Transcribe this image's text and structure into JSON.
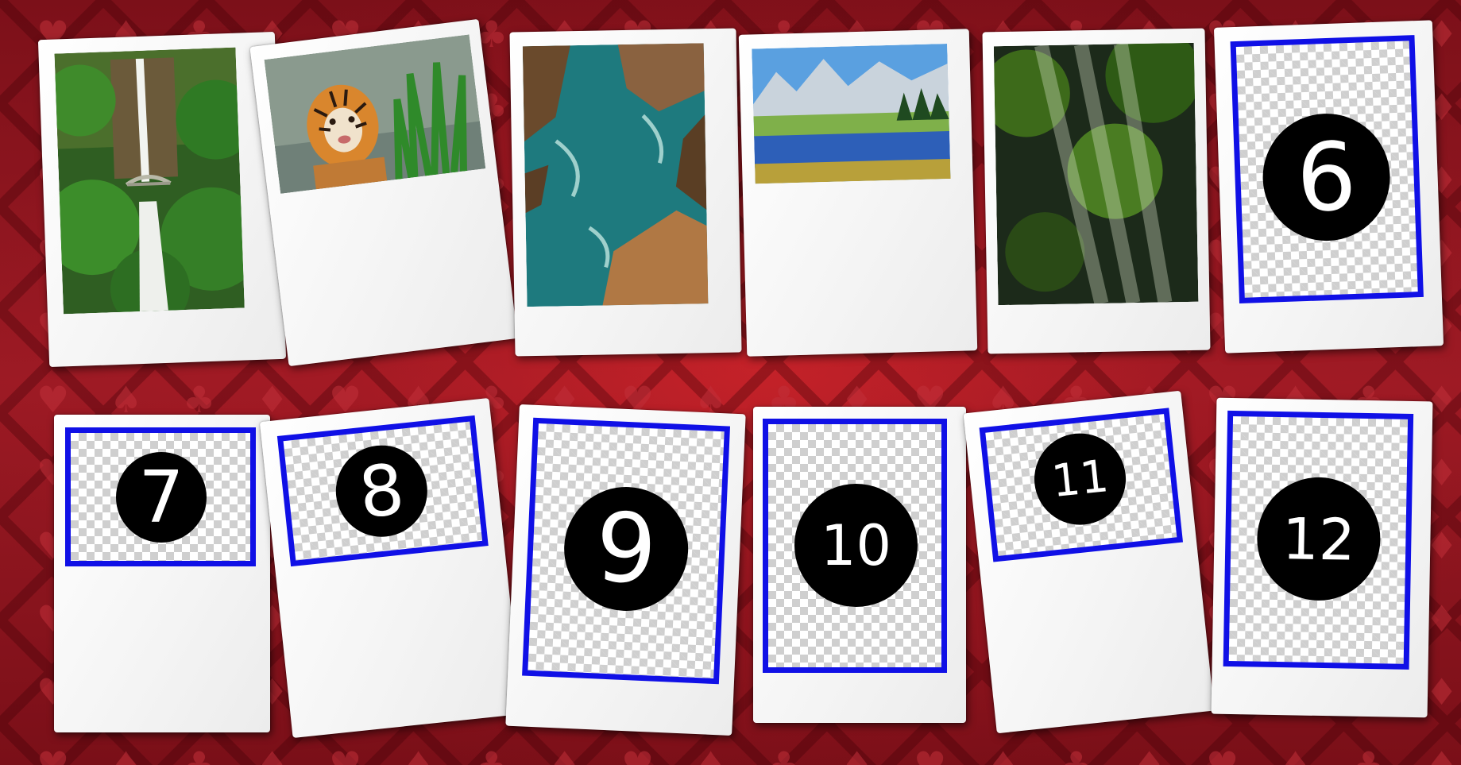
{
  "game": {
    "background_theme": "card-suits",
    "colors": {
      "felt": "#8e1620",
      "placeholder_border": "#1010e6",
      "number_circle": "#000000",
      "number_text": "#ffffff"
    },
    "cards": [
      {
        "id": 1,
        "type": "photo",
        "image": "waterfall"
      },
      {
        "id": 2,
        "type": "photo",
        "image": "tiger"
      },
      {
        "id": 3,
        "type": "photo",
        "image": "ocean-rocks"
      },
      {
        "id": 4,
        "type": "photo",
        "image": "mountain-lake"
      },
      {
        "id": 5,
        "type": "photo",
        "image": "forest-sunrays"
      },
      {
        "id": 6,
        "type": "placeholder",
        "label": "6"
      },
      {
        "id": 7,
        "type": "placeholder",
        "label": "7"
      },
      {
        "id": 8,
        "type": "placeholder",
        "label": "8"
      },
      {
        "id": 9,
        "type": "placeholder",
        "label": "9"
      },
      {
        "id": 10,
        "type": "placeholder",
        "label": "10"
      },
      {
        "id": 11,
        "type": "placeholder",
        "label": "11"
      },
      {
        "id": 12,
        "type": "placeholder",
        "label": "12"
      }
    ]
  }
}
